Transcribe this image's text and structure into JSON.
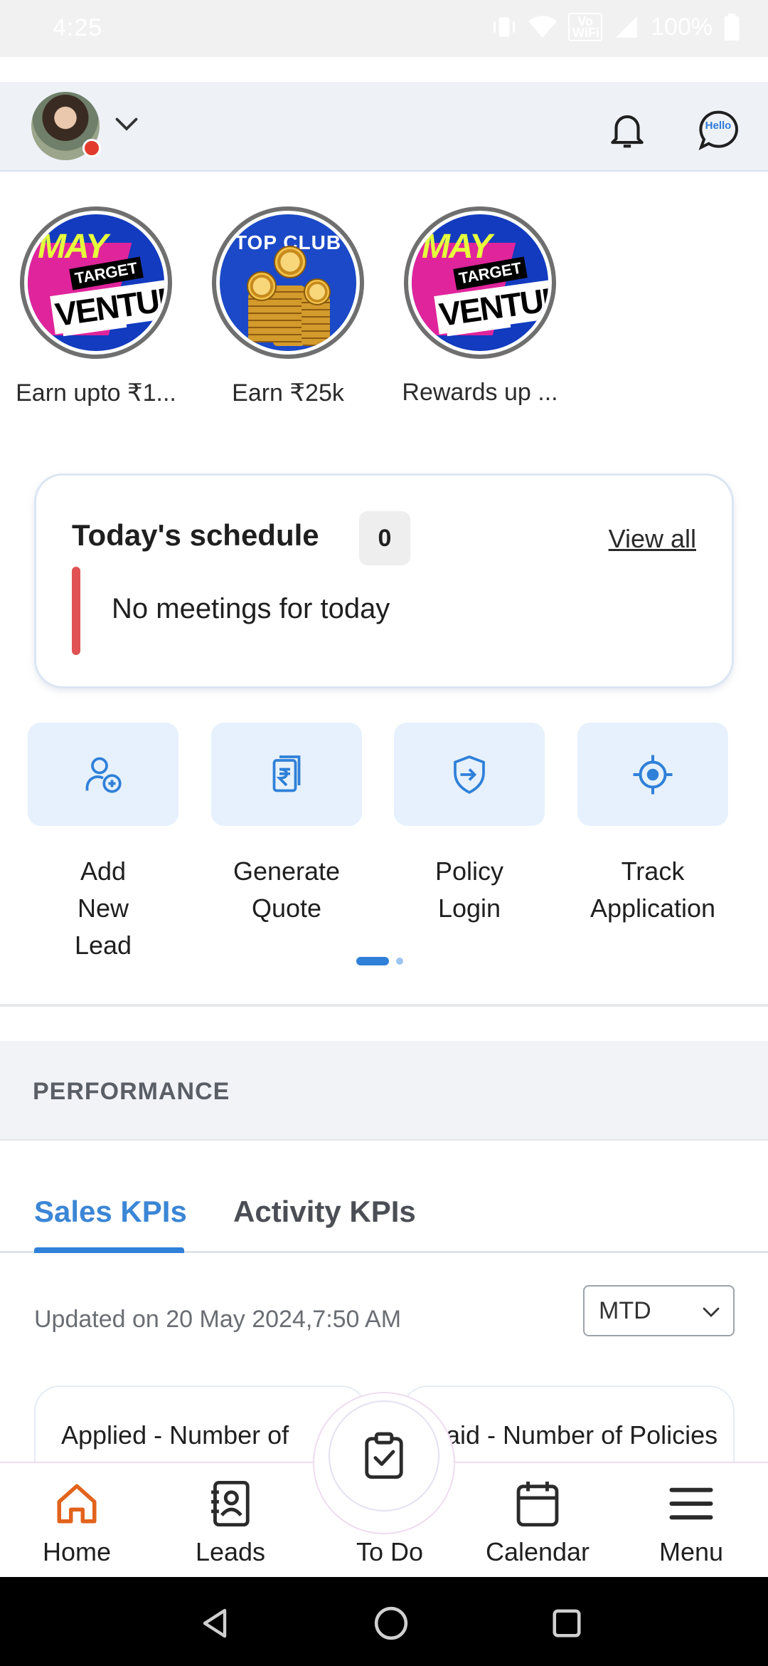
{
  "status_bar": {
    "time": "4:25",
    "volte": "Vo WiFi",
    "battery": "100%"
  },
  "stories": [
    {
      "label": "Earn upto ₹1...",
      "image": "venture",
      "may": "MAY",
      "target": "TARGET",
      "venture": "VENTURE"
    },
    {
      "label": "Earn ₹25k",
      "image": "club",
      "club_title": "TOP CLUB"
    },
    {
      "label": "Rewards up ...",
      "image": "venture",
      "may": "MAY",
      "target": "TARGET",
      "venture": "VENTURE"
    }
  ],
  "chat": {
    "hello": "Hello"
  },
  "schedule": {
    "title": "Today's schedule",
    "count": "0",
    "view_all": "View all",
    "empty": "No meetings for today",
    "accent": "#e05254"
  },
  "actions": [
    {
      "label": "Add New Lead",
      "icon": "add-user-icon"
    },
    {
      "label": "Generate Quote",
      "icon": "quote-document-icon"
    },
    {
      "label": "Policy Login",
      "icon": "policy-login-icon"
    },
    {
      "label": "Track Application",
      "icon": "crosshair-icon"
    }
  ],
  "performance": {
    "title": "PERFORMANCE",
    "tabs": [
      {
        "label": "Sales KPIs",
        "active": true
      },
      {
        "label": "Activity KPIs",
        "active": false
      }
    ],
    "updated": "Updated on 20 May 2024,7:50 AM",
    "period": "MTD",
    "cards": [
      {
        "label": "Applied - Number of Policies"
      },
      {
        "label": "Paid - Number of Policies"
      }
    ]
  },
  "bottom_nav": [
    {
      "label": "Home",
      "icon": "home-icon",
      "active": true
    },
    {
      "label": "Leads",
      "icon": "leads-icon"
    },
    {
      "label": "To Do",
      "icon": "todo-icon"
    },
    {
      "label": "Calendar",
      "icon": "calendar-icon"
    },
    {
      "label": "Menu",
      "icon": "menu-icon"
    }
  ],
  "colors": {
    "accent": "#2f80d8",
    "home_active": "#e2631c",
    "tile_bg": "#e6f1fd"
  }
}
